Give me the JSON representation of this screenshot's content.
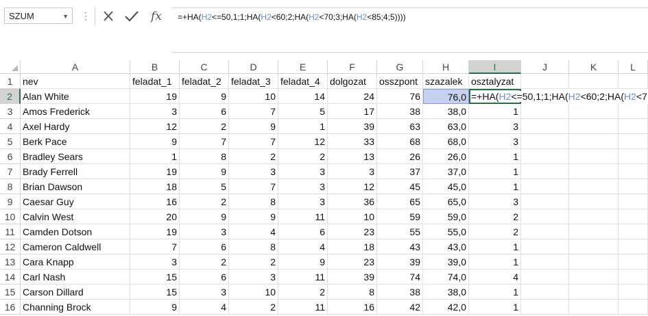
{
  "name_box": {
    "value": "SZUM"
  },
  "formula_bar": {
    "cancel_icon": "x-icon",
    "enter_icon": "check-icon",
    "fx_label": "fx",
    "formula_parts": [
      "=+HA(",
      "H2",
      "<=50,1;1;HA(",
      "H2",
      "<60;2;HA(",
      "H2",
      "<70;3;HA(",
      "H2",
      "<85;4;5))))"
    ]
  },
  "edit_cell": {
    "parts": [
      "=+HA(",
      "H2",
      "<=50,1;1;HA(",
      "H2",
      "<60;2;HA(",
      "H2",
      "<7"
    ]
  },
  "columns": [
    "A",
    "B",
    "C",
    "D",
    "E",
    "F",
    "G",
    "H",
    "I",
    "J",
    "K",
    "L"
  ],
  "headers": [
    "nev",
    "feladat_1",
    "feladat_2",
    "feladat_3",
    "feladat_4",
    "dolgozat",
    "osszpont",
    "szazalek",
    "osztalyzat"
  ],
  "rows": [
    {
      "n": "2",
      "nev": "Alan White",
      "f1": "19",
      "f2": "9",
      "f3": "10",
      "f4": "14",
      "dolg": "24",
      "ossz": "76",
      "sz": "76,0",
      "oszt": ""
    },
    {
      "n": "3",
      "nev": "Amos Frederick",
      "f1": "3",
      "f2": "6",
      "f3": "7",
      "f4": "5",
      "dolg": "17",
      "ossz": "38",
      "sz": "38,0",
      "oszt": "1"
    },
    {
      "n": "4",
      "nev": "Axel Hardy",
      "f1": "12",
      "f2": "2",
      "f3": "9",
      "f4": "1",
      "dolg": "39",
      "ossz": "63",
      "sz": "63,0",
      "oszt": "3"
    },
    {
      "n": "5",
      "nev": "Berk Pace",
      "f1": "9",
      "f2": "7",
      "f3": "7",
      "f4": "12",
      "dolg": "33",
      "ossz": "68",
      "sz": "68,0",
      "oszt": "3"
    },
    {
      "n": "6",
      "nev": "Bradley Sears",
      "f1": "1",
      "f2": "8",
      "f3": "2",
      "f4": "2",
      "dolg": "13",
      "ossz": "26",
      "sz": "26,0",
      "oszt": "1"
    },
    {
      "n": "7",
      "nev": "Brady Ferrell",
      "f1": "19",
      "f2": "9",
      "f3": "3",
      "f4": "3",
      "dolg": "3",
      "ossz": "37",
      "sz": "37,0",
      "oszt": "1"
    },
    {
      "n": "8",
      "nev": "Brian Dawson",
      "f1": "18",
      "f2": "5",
      "f3": "7",
      "f4": "3",
      "dolg": "12",
      "ossz": "45",
      "sz": "45,0",
      "oszt": "1"
    },
    {
      "n": "9",
      "nev": "Caesar Guy",
      "f1": "16",
      "f2": "2",
      "f3": "8",
      "f4": "3",
      "dolg": "36",
      "ossz": "65",
      "sz": "65,0",
      "oszt": "3"
    },
    {
      "n": "10",
      "nev": "Calvin West",
      "f1": "20",
      "f2": "9",
      "f3": "9",
      "f4": "11",
      "dolg": "10",
      "ossz": "59",
      "sz": "59,0",
      "oszt": "2"
    },
    {
      "n": "11",
      "nev": "Camden Dotson",
      "f1": "19",
      "f2": "3",
      "f3": "4",
      "f4": "6",
      "dolg": "23",
      "ossz": "55",
      "sz": "55,0",
      "oszt": "2"
    },
    {
      "n": "12",
      "nev": "Cameron Caldwell",
      "f1": "7",
      "f2": "6",
      "f3": "8",
      "f4": "4",
      "dolg": "18",
      "ossz": "43",
      "sz": "43,0",
      "oszt": "1"
    },
    {
      "n": "13",
      "nev": "Cara Knapp",
      "f1": "3",
      "f2": "2",
      "f3": "2",
      "f4": "9",
      "dolg": "23",
      "ossz": "39",
      "sz": "39,0",
      "oszt": "1"
    },
    {
      "n": "14",
      "nev": "Carl Nash",
      "f1": "15",
      "f2": "6",
      "f3": "3",
      "f4": "11",
      "dolg": "39",
      "ossz": "74",
      "sz": "74,0",
      "oszt": "4"
    },
    {
      "n": "15",
      "nev": "Carson Dillard",
      "f1": "15",
      "f2": "3",
      "f3": "10",
      "f4": "2",
      "dolg": "8",
      "ossz": "38",
      "sz": "38,0",
      "oszt": "1"
    },
    {
      "n": "16",
      "nev": "Channing Brock",
      "f1": "9",
      "f2": "4",
      "f3": "2",
      "f4": "11",
      "dolg": "16",
      "ossz": "42",
      "sz": "42,0",
      "oszt": "1"
    }
  ],
  "row_header_first": "1",
  "selected_column": "I",
  "selected_row": "2",
  "accent_color": "#217346"
}
